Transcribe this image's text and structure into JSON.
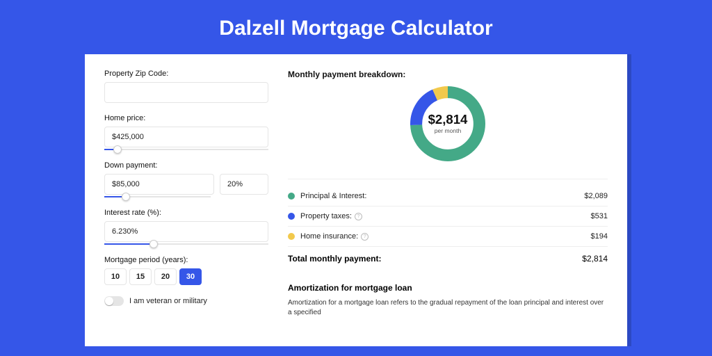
{
  "title": "Dalzell Mortgage Calculator",
  "form": {
    "zip_label": "Property Zip Code:",
    "zip_value": "",
    "price_label": "Home price:",
    "price_value": "$425,000",
    "price_slider_pct": 8,
    "down_label": "Down payment:",
    "down_value": "$85,000",
    "down_pct": "20%",
    "down_slider_pct": 20,
    "rate_label": "Interest rate (%):",
    "rate_value": "6.230%",
    "rate_slider_pct": 30,
    "period_label": "Mortgage period (years):",
    "periods": [
      "10",
      "15",
      "20",
      "30"
    ],
    "period_selected": "30",
    "veteran_label": "I am veteran or military"
  },
  "breakdown": {
    "title": "Monthly payment breakdown:",
    "center_amount": "$2,814",
    "center_sub": "per month",
    "items": [
      {
        "label": "Principal & Interest:",
        "value": "$2,089",
        "color": "#44a987",
        "info": false
      },
      {
        "label": "Property taxes:",
        "value": "$531",
        "color": "#3556e8",
        "info": true
      },
      {
        "label": "Home insurance:",
        "value": "$194",
        "color": "#f2c94c",
        "info": true
      }
    ],
    "total_label": "Total monthly payment:",
    "total_value": "$2,814"
  },
  "amort": {
    "title": "Amortization for mortgage loan",
    "text": "Amortization for a mortgage loan refers to the gradual repayment of the loan principal and interest over a specified"
  },
  "chart_data": {
    "type": "pie",
    "title": "Monthly payment breakdown",
    "series": [
      {
        "name": "Principal & Interest",
        "value": 2089,
        "color": "#44a987"
      },
      {
        "name": "Property taxes",
        "value": 531,
        "color": "#3556e8"
      },
      {
        "name": "Home insurance",
        "value": 194,
        "color": "#f2c94c"
      }
    ],
    "total": 2814,
    "center_label": "$2,814 per month"
  }
}
